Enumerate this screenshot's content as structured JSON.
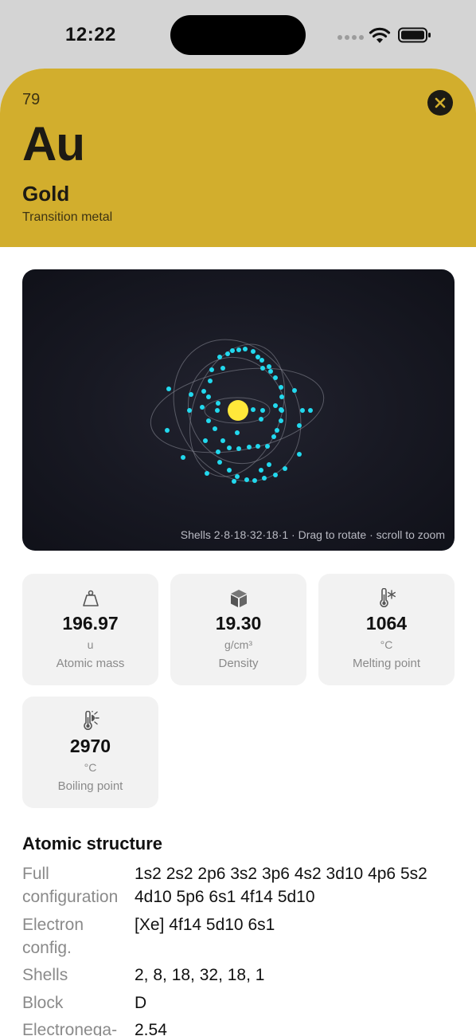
{
  "status_bar": {
    "time": "12:22"
  },
  "element": {
    "atomic_number": "79",
    "symbol": "Au",
    "name": "Gold",
    "category": "Transition metal",
    "header_color": "#d2ae2d"
  },
  "atom_viewer": {
    "caption": "Shells 2·8·18·32·18·1  ·  Drag to rotate · scroll to zoom",
    "nucleus_color": "#ffe83a",
    "electron_color": "#22d9ee"
  },
  "properties": [
    {
      "icon": "weight-icon",
      "value": "196.97",
      "unit": "u",
      "label": "Atomic mass"
    },
    {
      "icon": "cube-icon",
      "value": "19.30",
      "unit": "g/cm³",
      "label": "Density"
    },
    {
      "icon": "thermometer-snowflake-icon",
      "value": "1064",
      "unit": "°C",
      "label": "Melting point"
    },
    {
      "icon": "thermometer-sun-icon",
      "value": "2970",
      "unit": "°C",
      "label": "Boiling point"
    }
  ],
  "atomic_structure": {
    "title": "Atomic structure",
    "rows": [
      {
        "label": "Full configuration",
        "value": "1s2 2s2 2p6 3s2 3p6 4s2 3d10 4p6 5s2 4d10 5p6 6s1 4f14 5d10"
      },
      {
        "label": "Electron config.",
        "value": "[Xe] 4f14 5d10 6s1"
      },
      {
        "label": "Shells",
        "value": "2, 8, 18, 32, 18, 1"
      },
      {
        "label": "Block",
        "value": "D"
      },
      {
        "label": "Electronega-",
        "value": "2.54"
      }
    ]
  }
}
